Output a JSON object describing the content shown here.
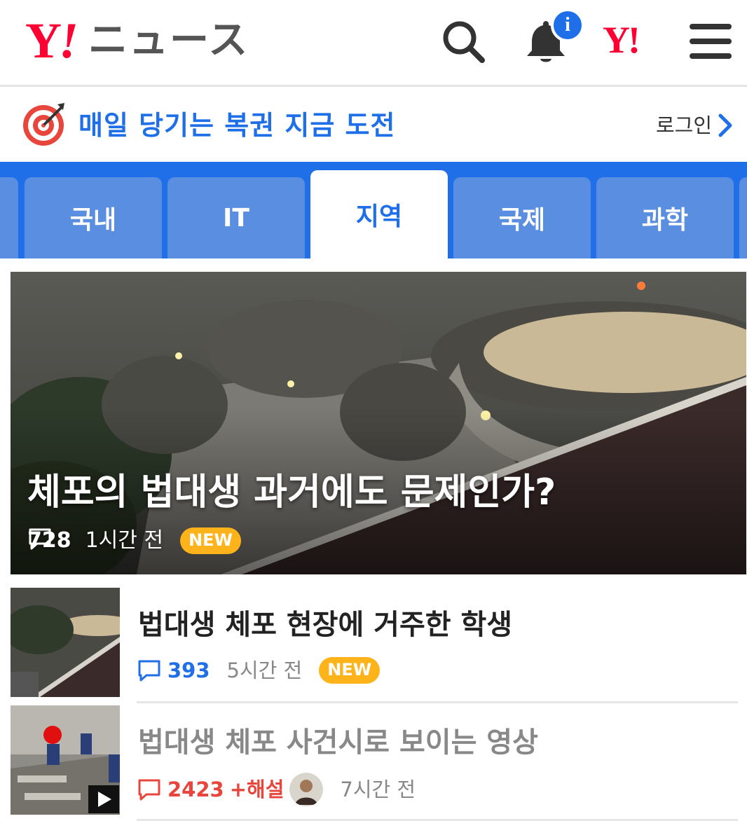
{
  "header": {
    "logo_y": "Y",
    "logo_bang": "!",
    "logo_text": "ニュース",
    "notification_badge": "i",
    "yahoo_mark": "Y!",
    "icons": [
      "search-icon",
      "bell-icon",
      "yahoo-logo-icon",
      "menu-icon"
    ]
  },
  "promo": {
    "label": "매일 당기는 복권 지금 도전",
    "login_label": "로그인",
    "icon": "target-icon"
  },
  "tabs": [
    {
      "label": ""
    },
    {
      "label": "국내"
    },
    {
      "label": "IT"
    },
    {
      "label": "지역",
      "active": true
    },
    {
      "label": "국제"
    },
    {
      "label": "과학"
    }
  ],
  "hero": {
    "title": "체포의 법대생 과거에도 문제인가?",
    "comments": "728",
    "time": "1시간 전",
    "badge": "NEW"
  },
  "articles": [
    {
      "title": "법대생 체포 현장에 거주한 학생",
      "comments": "393",
      "time": "5시간 전",
      "badge": "NEW",
      "comment_color": "#1e6fe8"
    },
    {
      "title": "법대생 체포 사건시로 보이는 영상",
      "comments": "2423",
      "extra": "+해설",
      "time": "7시간 전",
      "comment_color": "#e8453c",
      "has_video": true
    }
  ],
  "colors": {
    "brand_red": "#ff0033",
    "accent_blue": "#1e6fe8",
    "tab_inactive": "#5a8ee0",
    "new_badge": "#ffb31a",
    "hot_red": "#e8453c"
  }
}
